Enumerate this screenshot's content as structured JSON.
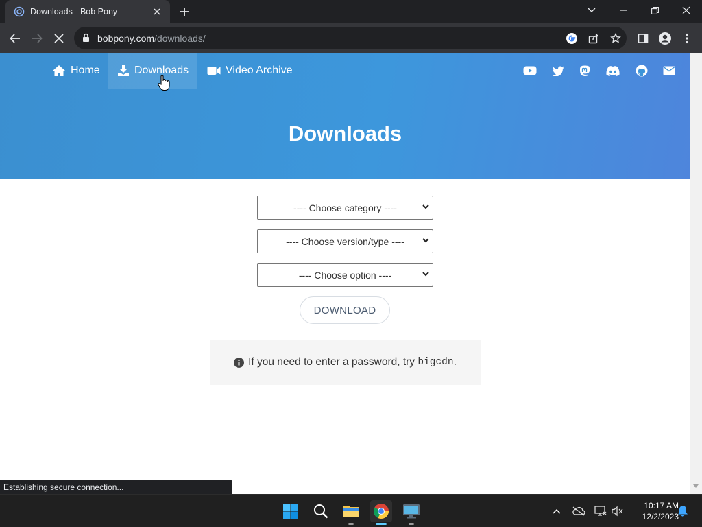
{
  "browser": {
    "tab_title": "Downloads - Bob Pony",
    "url_host": "bobpony.com",
    "url_path": "/downloads/",
    "status_text": "Establishing secure connection..."
  },
  "nav": {
    "items": [
      {
        "label": "Home",
        "icon": "home-icon"
      },
      {
        "label": "Downloads",
        "icon": "download-icon"
      },
      {
        "label": "Video Archive",
        "icon": "video-icon"
      }
    ],
    "social_icons": [
      "youtube-icon",
      "twitter-icon",
      "mastodon-icon",
      "discord-icon",
      "github-icon",
      "mail-icon"
    ]
  },
  "page": {
    "title": "Downloads",
    "select_category": "---- Choose category ----",
    "select_version": "---- Choose version/type ----",
    "select_option": "---- Choose option ----",
    "download_label": "DOWNLOAD",
    "info_text": "If you need to enter a password, try ",
    "info_code": "bigcdn",
    "info_end": "."
  },
  "taskbar": {
    "time": "10:17 AM",
    "date": "12/2/2023"
  },
  "colors": {
    "hero_start": "#3b8fd0",
    "hero_end": "#4e85dc",
    "chrome_dark": "#202124",
    "chrome_toolbar": "#35363a"
  }
}
